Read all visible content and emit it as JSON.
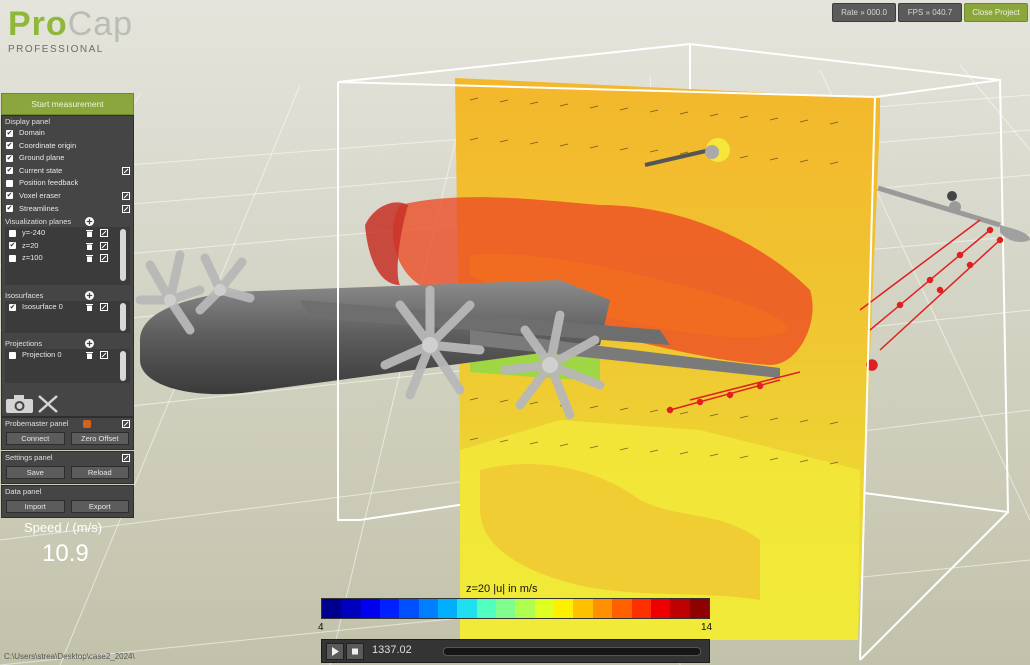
{
  "app": {
    "logo_pro": "Pro",
    "logo_cap": "Cap",
    "logo_sub": "PROFESSIONAL"
  },
  "toolbar": {
    "rate_label": "Rate » 000.0",
    "fps_label": "FPS » 040.7",
    "close_label": "Close Project"
  },
  "start_label": "Start measurement",
  "display_panel": {
    "title": "Display panel",
    "items": [
      {
        "label": "Domain",
        "checked": true,
        "edit": false
      },
      {
        "label": "Coordinate origin",
        "checked": true,
        "edit": false
      },
      {
        "label": "Ground plane",
        "checked": true,
        "edit": false
      },
      {
        "label": "Current state",
        "checked": true,
        "edit": true
      },
      {
        "label": "Position feedback",
        "checked": false,
        "edit": false
      },
      {
        "label": "Voxel eraser",
        "checked": true,
        "edit": true
      },
      {
        "label": "Streamlines",
        "checked": true,
        "edit": true
      }
    ]
  },
  "visualization_planes": {
    "title": "Visualization planes",
    "items": [
      {
        "label": "y=-240",
        "checked": false
      },
      {
        "label": "z=20",
        "checked": true
      },
      {
        "label": "z=100",
        "checked": false
      }
    ]
  },
  "isosurfaces": {
    "title": "Isosurfaces",
    "items": [
      {
        "label": "Isosurface 0",
        "checked": true
      }
    ]
  },
  "projections": {
    "title": "Projections",
    "items": [
      {
        "label": "Projection 0",
        "checked": false
      }
    ]
  },
  "probemaster": {
    "title": "Probemaster panel",
    "status_color": "#d4621e",
    "connect_label": "Connect",
    "zero_offset_label": "Zero Offset"
  },
  "settings": {
    "title": "Settings panel",
    "save_label": "Save",
    "reload_label": "Reload"
  },
  "data_panel": {
    "title": "Data panel",
    "import_label": "Import",
    "export_label": "Export"
  },
  "speed": {
    "label": "Speed / (m/s)",
    "value": "10.9"
  },
  "status_path": "C:\\Users\\strea\\Desktop\\case2_2024\\",
  "color_scale": {
    "title": "z=20 |u| in m/s",
    "min": "4",
    "max": "14",
    "colors": [
      "#00008f",
      "#0000bf",
      "#0000ef",
      "#0020ff",
      "#0050ff",
      "#0080ff",
      "#00b0ff",
      "#20e0ef",
      "#50ffbf",
      "#80ff8f",
      "#b0ff50",
      "#dfff20",
      "#ffef00",
      "#ffc000",
      "#ff9000",
      "#ff6000",
      "#ff3000",
      "#ef0000",
      "#bf0000",
      "#8f0000"
    ]
  },
  "player": {
    "time": "1337.02",
    "progress": 0.0
  },
  "accent_color": "#8aa63c"
}
